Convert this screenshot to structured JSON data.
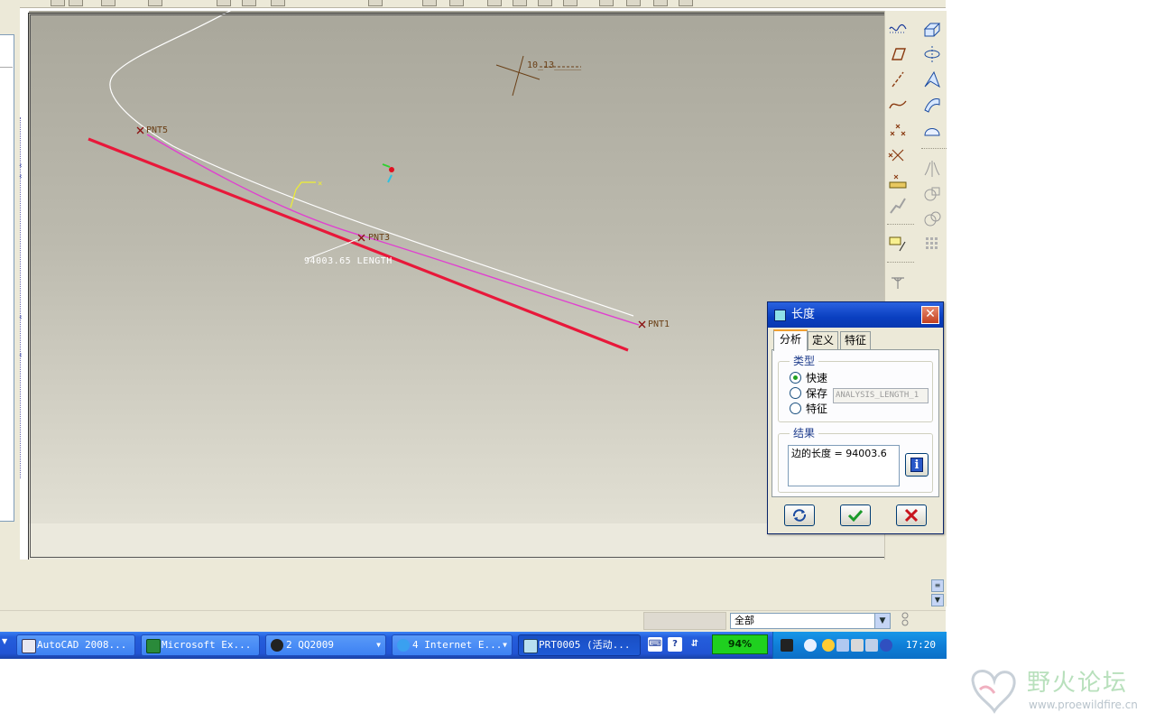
{
  "graphics": {
    "labels": {
      "pnt5": "PNT5",
      "pnt3": "PNT3",
      "pnt1": "PNT1",
      "csys": "10_13_____",
      "dimension": "94003.65 LENGTH"
    },
    "colors": {
      "measure_line": "#e8183a",
      "curve_magenta": "#e040d0",
      "datum_label": "#6a3f16"
    }
  },
  "dialog": {
    "title": "长度",
    "close_icon": "close-icon",
    "tabs": [
      "分析",
      "定义",
      "特征"
    ],
    "active_tab": "分析",
    "type_group": {
      "legend": "类型",
      "options": [
        "快速",
        "保存",
        "特征"
      ],
      "selected": "快速",
      "name_field_value": "ANALYSIS_LENGTH_1"
    },
    "result_group": {
      "legend": "结果",
      "text": "边的长度 = 94003.6",
      "info_icon": "info-icon"
    },
    "buttons": {
      "repeat": "repeat-icon",
      "ok": "checkmark-icon",
      "cancel": "x-icon"
    }
  },
  "status": {
    "filter_value": "全部"
  },
  "taskbar": {
    "items": [
      {
        "label": "AutoCAD 2008..."
      },
      {
        "label": "Microsoft Ex..."
      },
      {
        "label": "2 QQ2009"
      },
      {
        "label": "4 Internet E..."
      },
      {
        "label": "PRT0005 (活动..."
      }
    ],
    "cpu": "94%",
    "clock": "17:20"
  },
  "watermark": {
    "title": "野火论坛",
    "url": "www.proewildfire.cn"
  }
}
